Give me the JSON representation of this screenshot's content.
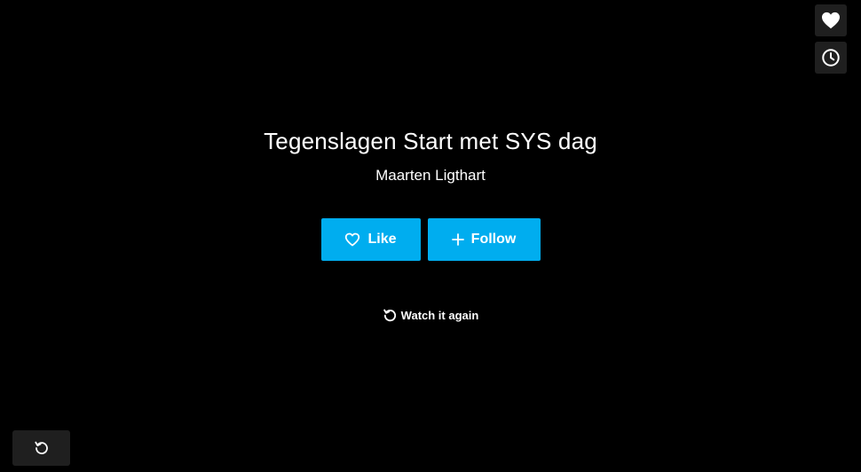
{
  "sidebar": {
    "like_icon": "heart-icon",
    "watch_later_icon": "clock-icon"
  },
  "end_screen": {
    "title": "Tegenslagen Start met SYS dag",
    "author": "Maarten Ligthart",
    "like_label": "Like",
    "follow_label": "Follow",
    "watch_again_label": "Watch it again"
  },
  "controls": {
    "replay_icon": "replay-icon"
  },
  "colors": {
    "background": "#000000",
    "accent": "#00adef",
    "control_bg": "#1f1f1f",
    "text": "#ffffff"
  }
}
